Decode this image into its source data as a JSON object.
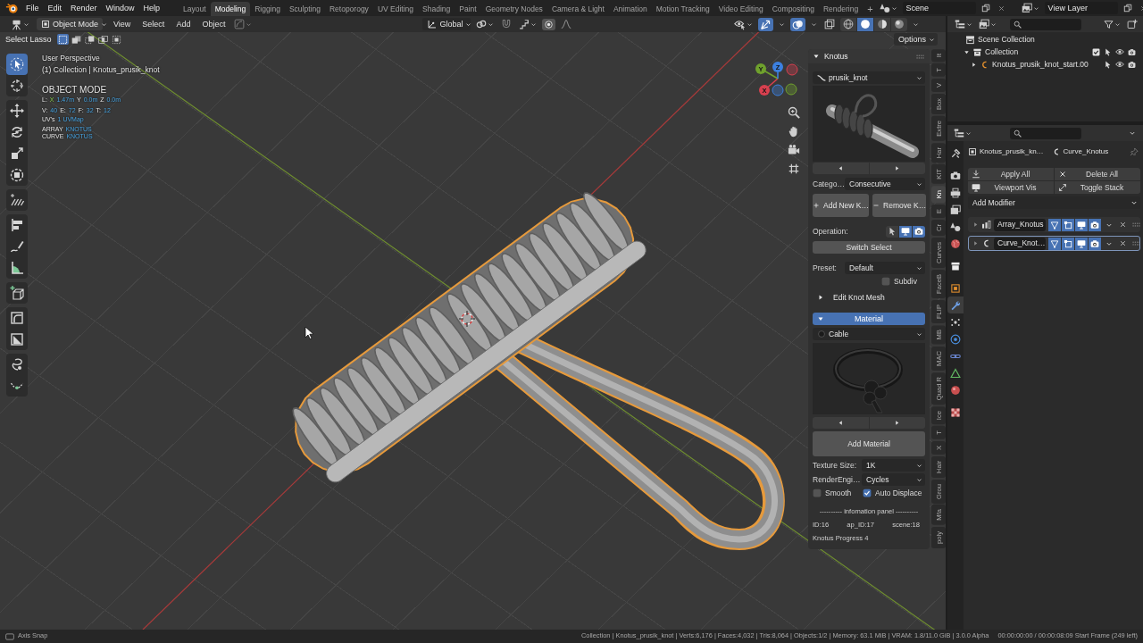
{
  "top_bar": {
    "menus": [
      "File",
      "Edit",
      "Render",
      "Window",
      "Help"
    ],
    "workspaces": [
      {
        "label": "Layout",
        "selected": false
      },
      {
        "label": "Modeling",
        "selected": true
      },
      {
        "label": "Rigging",
        "selected": false
      },
      {
        "label": "Sculpting",
        "selected": false
      },
      {
        "label": "Retoporogy",
        "selected": false
      },
      {
        "label": "UV Editing",
        "selected": false
      },
      {
        "label": "Shading",
        "selected": false
      },
      {
        "label": "Paint",
        "selected": false
      },
      {
        "label": "Geometry Nodes",
        "selected": false
      },
      {
        "label": "Camera & Light",
        "selected": false
      },
      {
        "label": "Animation",
        "selected": false
      },
      {
        "label": "Motion Tracking",
        "selected": false
      },
      {
        "label": "Video Editing",
        "selected": false
      },
      {
        "label": "Compositing",
        "selected": false
      },
      {
        "label": "Rendering",
        "selected": false
      }
    ],
    "add_workspace": "+",
    "scene": "Scene",
    "view_layer": "View Layer"
  },
  "viewport_header": {
    "mode": "Object Mode",
    "menus": [
      "View",
      "Select",
      "Add",
      "Object"
    ],
    "orientation": "Global",
    "snapping": false,
    "proportional_editing": false,
    "show_gizmos": true,
    "show_overlays": true,
    "shading": [
      {
        "kind": "wireframe",
        "selected": false
      },
      {
        "kind": "solid",
        "selected": true
      },
      {
        "kind": "material",
        "selected": false
      },
      {
        "kind": "rendered",
        "selected": false
      }
    ]
  },
  "tool_settings": {
    "tool": "Select Lasso",
    "select_modes": [
      {
        "kind": "set",
        "selected": true
      },
      {
        "kind": "extend",
        "selected": false
      },
      {
        "kind": "subtract",
        "selected": false
      },
      {
        "kind": "invert",
        "selected": false
      },
      {
        "kind": "intersect",
        "selected": false
      }
    ],
    "options": "Options"
  },
  "toolbar": {
    "groups": [
      {
        "tools": [
          {
            "kind": "select",
            "selected": true
          },
          {
            "kind": "cursor",
            "selected": false
          }
        ]
      },
      {
        "tools": [
          {
            "kind": "move",
            "selected": false
          },
          {
            "kind": "rotate",
            "selected": false
          },
          {
            "kind": "scale",
            "selected": false
          },
          {
            "kind": "transform",
            "selected": false
          }
        ]
      },
      {
        "tools": [
          {
            "kind": "annotate",
            "selected": false
          }
        ]
      },
      {
        "tools": [
          {
            "kind": "align",
            "selected": false
          },
          {
            "kind": "draw",
            "selected": false
          },
          {
            "kind": "measure",
            "selected": false
          }
        ]
      },
      {
        "tools": [
          {
            "kind": "add_cube",
            "selected": false
          }
        ]
      },
      {
        "tools": [
          {
            "kind": "corner",
            "selected": false
          },
          {
            "kind": "diagonal",
            "selected": false
          }
        ]
      },
      {
        "tools": [
          {
            "kind": "lasso",
            "selected": false
          },
          {
            "kind": "curve",
            "selected": false
          }
        ]
      }
    ]
  },
  "viewport_info": {
    "view": "User Perspective",
    "context": "(1) Collection | Knotus_prusik_knot",
    "mode": "OBJECT MODE",
    "stats": [
      {
        "kind": "location",
        "prefix": "L:",
        "pairs": [
          {
            "label": "X",
            "value": "1.47m"
          },
          {
            "label": "Y",
            "value": "0.0m"
          },
          {
            "label": "Z",
            "value": "0.0m"
          }
        ]
      },
      {
        "kind": "counts",
        "pairs": [
          {
            "label": "V:",
            "value": "40"
          },
          {
            "label": "E:",
            "value": "72"
          },
          {
            "label": "F:",
            "value": "32"
          },
          {
            "label": "T:",
            "value": "12"
          }
        ]
      },
      {
        "kind": "counts",
        "pairs": [
          {
            "label": "UV's",
            "value": "1 UVMap"
          }
        ]
      },
      {
        "kind": "names",
        "pairs": [
          {
            "label": "ARRAY",
            "value": "KNOTUS"
          }
        ]
      },
      {
        "kind": "names",
        "pairs": [
          {
            "label": "CURVE",
            "value": "KNOTUS"
          }
        ]
      }
    ]
  },
  "gizmo": {
    "axes": [
      {
        "label": "X",
        "color": "#d8404f"
      },
      {
        "label": "Y",
        "color": "#6fa12d"
      },
      {
        "label": "Z",
        "color": "#3c80e0"
      }
    ]
  },
  "knotus_panel": {
    "header": {
      "label": "Knotus",
      "expanded": true
    },
    "knot": "prusik_knot",
    "category_label": "Catego…",
    "category": "Consecutive",
    "add_button": "Add New K…",
    "remove_button": "Remove K…",
    "operation_label": "Operation:",
    "operation_toggles": [
      {
        "kind": "select",
        "selected": false
      },
      {
        "kind": "viewport",
        "selected": true
      },
      {
        "kind": "render",
        "selected": true
      }
    ],
    "switch_button": "Switch Select",
    "preset_label": "Preset:",
    "preset": "Default",
    "subdiv": {
      "label": "Subdiv",
      "checked": false
    },
    "edit_knot_mesh": {
      "label": "Edit Knot Mesh",
      "expanded": false
    },
    "material_section": {
      "label": "Material",
      "expanded": true
    },
    "material": "Cable",
    "add_material": "Add Material",
    "texture_size_label": "Texture Size:",
    "texture_size": "1K",
    "render_engine_label": "RenderEngi…",
    "render_engine": "Cycles",
    "smooth": {
      "label": "Smooth",
      "checked": false
    },
    "auto_displace": {
      "label": "Auto Displace",
      "checked": true
    },
    "info_title": "---------- infomation panel ----------",
    "info": [
      "ID:16",
      "ap_ID:17",
      "scene:18"
    ],
    "progress": "Knotus Progress 4"
  },
  "side_tabs": [
    {
      "label": "It",
      "selected": false
    },
    {
      "label": "T",
      "selected": false
    },
    {
      "label": "V",
      "selected": false
    },
    {
      "label": "Box",
      "selected": false
    },
    {
      "label": "Extre",
      "selected": false
    },
    {
      "label": "Har",
      "selected": false
    },
    {
      "label": "KIT",
      "selected": false
    },
    {
      "label": "Kn",
      "selected": true
    },
    {
      "label": "E",
      "selected": false
    },
    {
      "label": "Cr",
      "selected": false
    },
    {
      "label": "Curves",
      "selected": false
    },
    {
      "label": "FaceB",
      "selected": false
    },
    {
      "label": "FLIP",
      "selected": false
    },
    {
      "label": "MB",
      "selected": false
    },
    {
      "label": "MAC",
      "selected": false
    },
    {
      "label": "Quad R",
      "selected": false
    },
    {
      "label": "Ice",
      "selected": false
    },
    {
      "label": "T",
      "selected": false
    },
    {
      "label": "X",
      "selected": false
    },
    {
      "label": "Hair",
      "selected": false
    },
    {
      "label": "Grou",
      "selected": false
    },
    {
      "label": "Mfa",
      "selected": false
    },
    {
      "label": "poly",
      "selected": false
    }
  ],
  "outliner": {
    "tree": [
      {
        "label": "Scene Collection",
        "kind": "scene",
        "children": [
          {
            "label": "Collection",
            "kind": "collection",
            "expanded": true,
            "checked": true,
            "children": [
              {
                "label": "Knotus_prusik_knot_start.00",
                "kind": "object",
                "expanded": false
              }
            ]
          }
        ]
      }
    ]
  },
  "properties": {
    "tabs": [
      {
        "kind": "tool",
        "selected": false
      },
      {
        "kind": "render",
        "selected": false
      },
      {
        "kind": "output",
        "selected": false
      },
      {
        "kind": "view_layer",
        "selected": false
      },
      {
        "kind": "scene",
        "selected": false
      },
      {
        "kind": "world",
        "selected": false
      },
      {
        "kind": "collection",
        "selected": false
      },
      {
        "kind": "object",
        "selected": false
      },
      {
        "kind": "modifiers",
        "selected": true
      },
      {
        "kind": "particles",
        "selected": false
      },
      {
        "kind": "physics",
        "selected": false
      },
      {
        "kind": "constraints",
        "selected": false
      },
      {
        "kind": "data",
        "selected": false
      },
      {
        "kind": "material",
        "selected": false
      },
      {
        "kind": "texture",
        "selected": false
      }
    ],
    "object_name": "Knotus_prusik_kn…",
    "data_name": "Curve_Knotus",
    "actions": [
      {
        "kind": "apply",
        "label": "Apply All"
      },
      {
        "kind": "delete",
        "label": "Delete All"
      },
      {
        "kind": "viewport",
        "label": "Viewport Vis"
      },
      {
        "kind": "toggle",
        "label": "Toggle Stack"
      }
    ],
    "add_modifier": "Add Modifier",
    "modifiers": [
      {
        "kind": "array",
        "name": "Array_Knotus",
        "selected": false,
        "toggles": [
          {
            "kind": "on_cage",
            "on": true
          },
          {
            "kind": "edit_mode",
            "on": true
          },
          {
            "kind": "viewport",
            "on": true
          },
          {
            "kind": "render",
            "on": true
          }
        ]
      },
      {
        "kind": "curve",
        "name": "Curve_Knot…",
        "selected": true,
        "toggles": [
          {
            "kind": "on_cage",
            "on": true
          },
          {
            "kind": "edit_mode",
            "on": true
          },
          {
            "kind": "viewport",
            "on": true
          },
          {
            "kind": "render",
            "on": true
          }
        ]
      }
    ]
  },
  "status_bar": {
    "hint": "Axis Snap",
    "stats": "Collection | Knotus_prusik_knot | Verts:6,176 | Faces:4,032 | Tris:8,064 | Objects:1/2 | Memory: 63.1 MiB | VRAM: 1.8/11.0 GiB | 3.0.0 Alpha",
    "time": "00:00:00:00 / 00:00:08:09 Start Frame (249 left)"
  }
}
